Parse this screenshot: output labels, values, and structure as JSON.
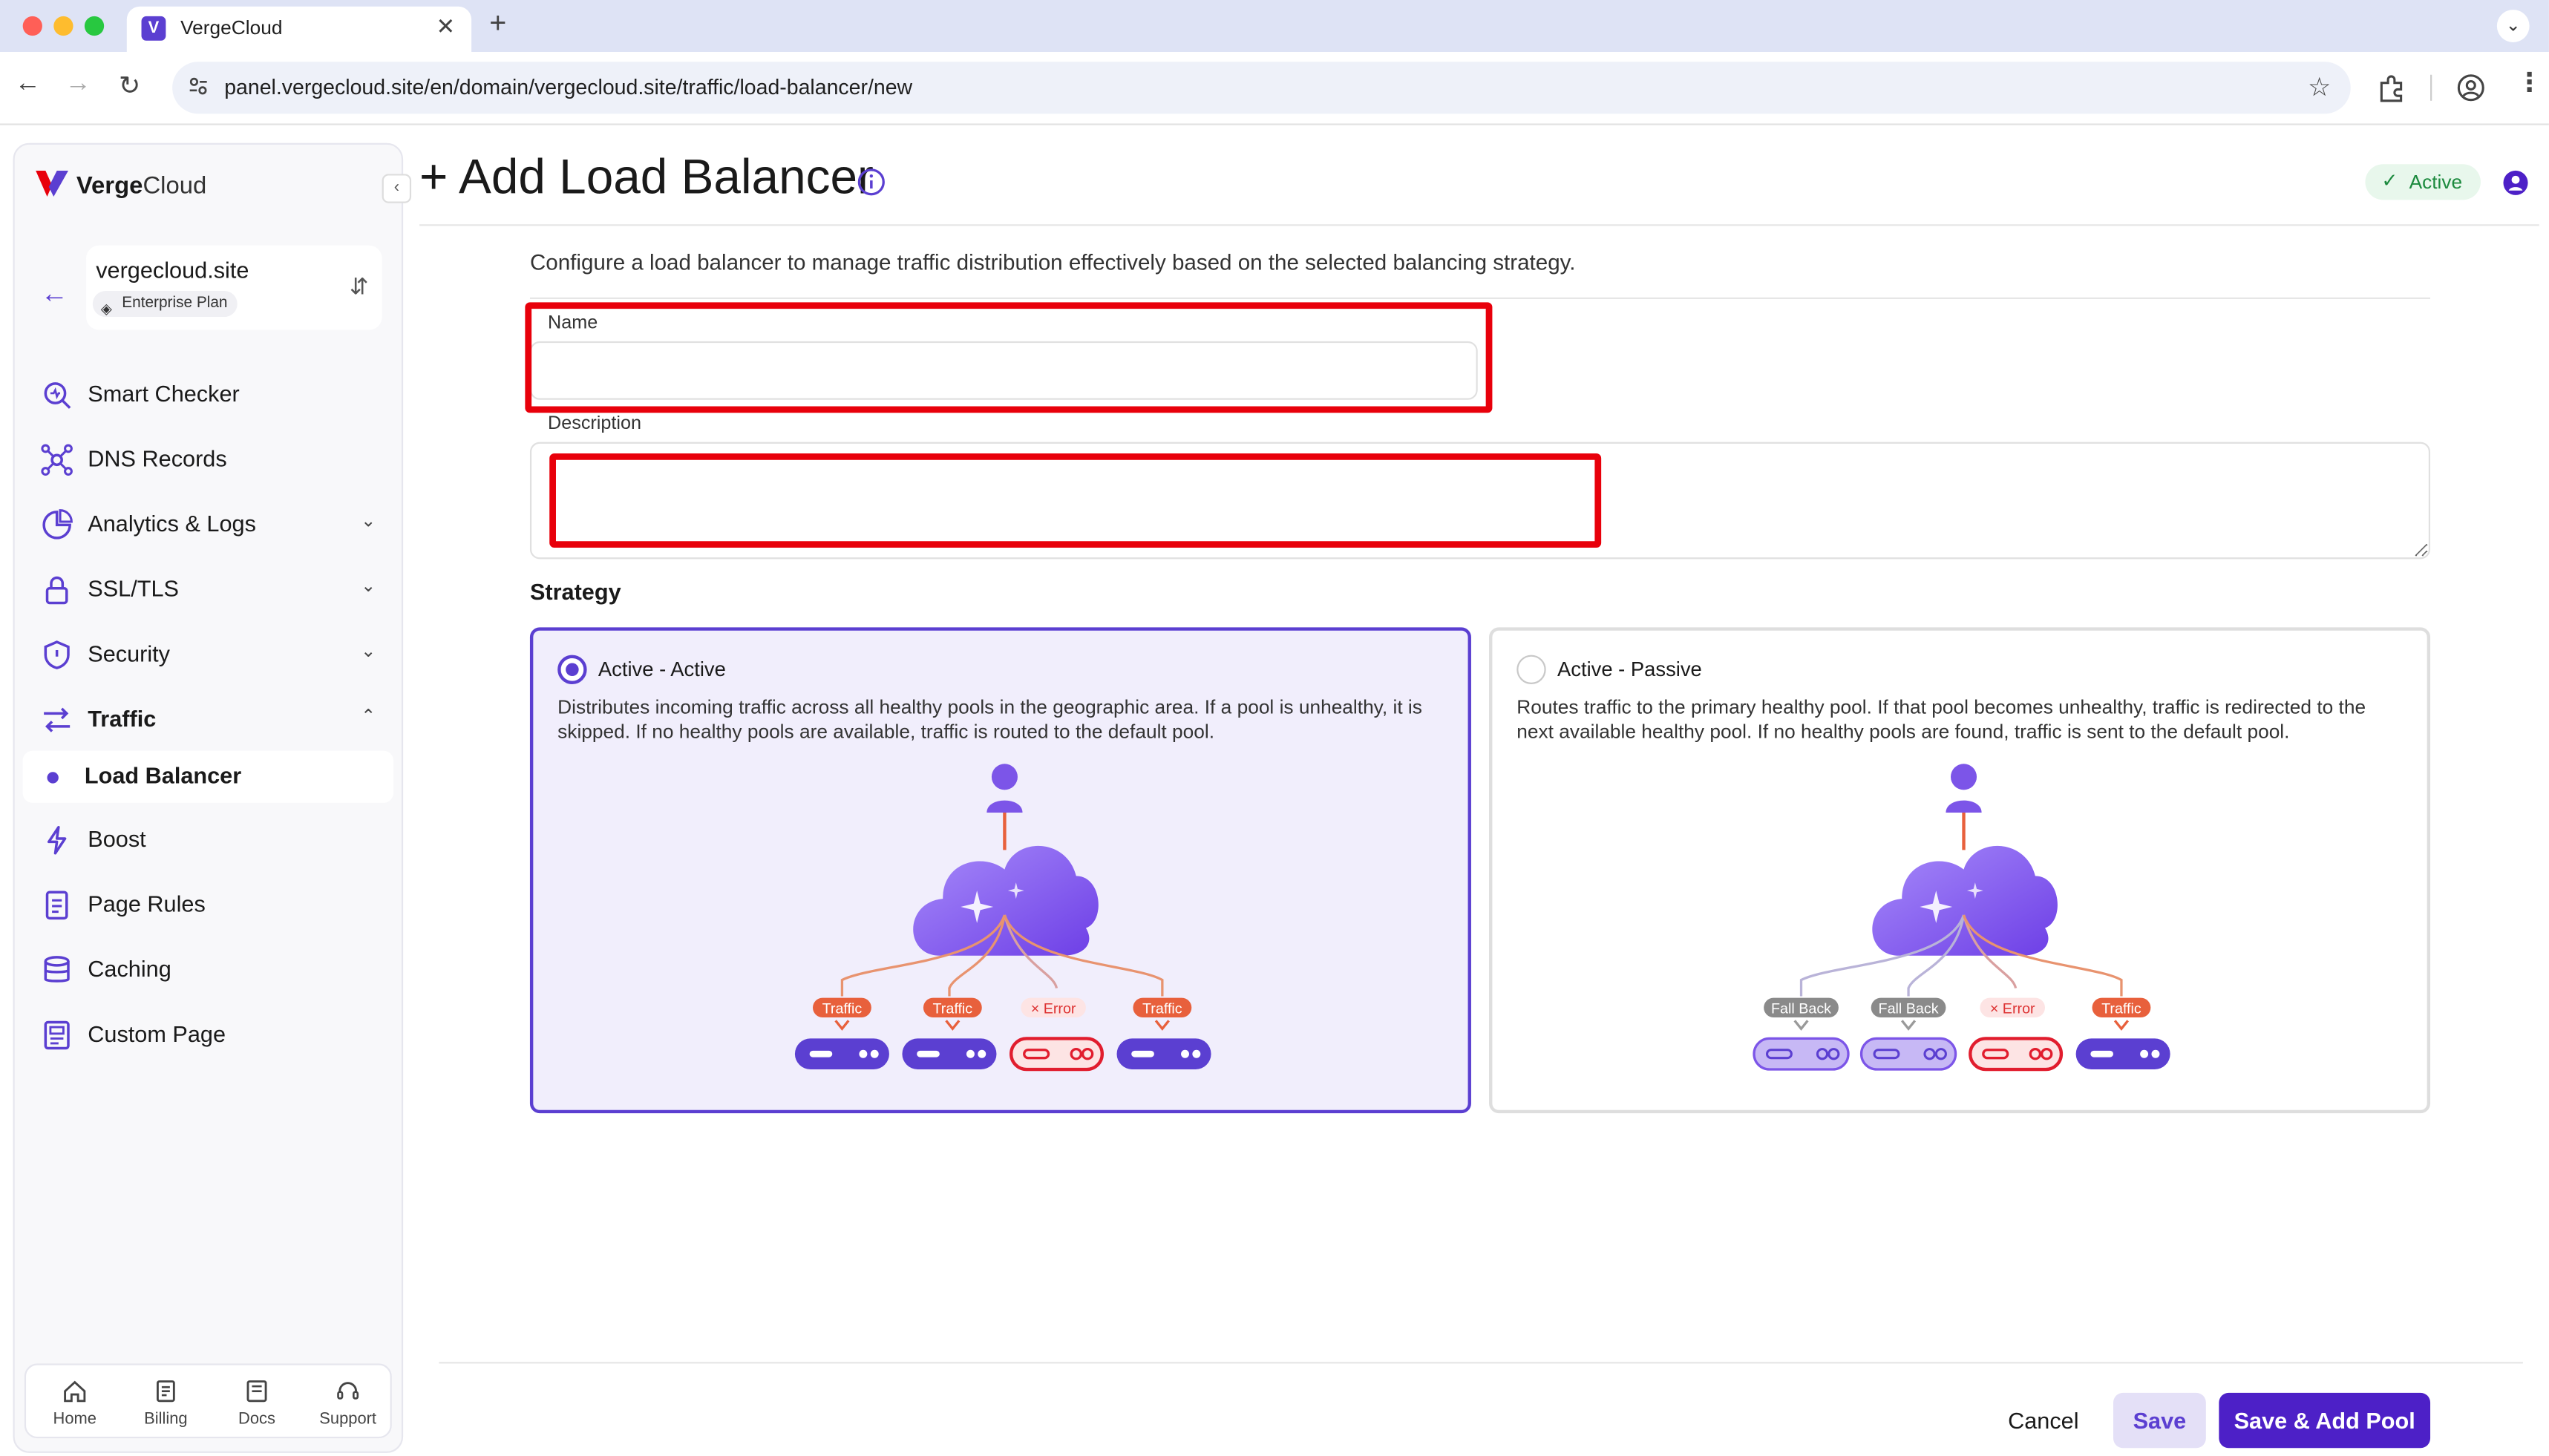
{
  "browser": {
    "tab_title": "VergeCloud",
    "url": "panel.vergecloud.site/en/domain/vergecloud.site/traffic/load-balancer/new"
  },
  "sidebar": {
    "brand": {
      "strong": "Verge",
      "light": "Cloud"
    },
    "site": {
      "name": "vergecloud.site",
      "plan": "Enterprise Plan"
    },
    "items": [
      {
        "label": "Smart Checker",
        "icon": "smart-checker-icon"
      },
      {
        "label": "DNS Records",
        "icon": "dns-icon"
      },
      {
        "label": "Analytics & Logs",
        "icon": "analytics-icon"
      },
      {
        "label": "SSL/TLS",
        "icon": "lock-icon"
      },
      {
        "label": "Security",
        "icon": "shield-icon"
      },
      {
        "label": "Traffic",
        "icon": "traffic-icon"
      },
      {
        "label": "Boost",
        "icon": "bolt-icon"
      },
      {
        "label": "Page Rules",
        "icon": "page-rules-icon"
      },
      {
        "label": "Caching",
        "icon": "database-icon"
      },
      {
        "label": "Custom Page",
        "icon": "custom-page-icon"
      }
    ],
    "active_subitem": "Load Balancer",
    "bottom_nav": [
      {
        "label": "Home",
        "icon": "home-icon"
      },
      {
        "label": "Billing",
        "icon": "billing-icon"
      },
      {
        "label": "Docs",
        "icon": "docs-icon"
      },
      {
        "label": "Support",
        "icon": "support-icon"
      }
    ]
  },
  "header": {
    "title": "+ Add Load Balancer",
    "status": "Active"
  },
  "form": {
    "intro": "Configure a load balancer to manage traffic distribution effectively based on the selected balancing strategy.",
    "name_label": "Name",
    "name_value": "",
    "description_label": "Description",
    "description_value": "",
    "strategy_label": "Strategy"
  },
  "strategies": [
    {
      "title": "Active - Active",
      "selected": true,
      "description": "Distributes incoming traffic across all healthy pools in the geographic area. If a pool is unhealthy, it is skipped. If no healthy pools are available, traffic is routed to the default pool.",
      "labels": [
        "Traffic",
        "Traffic",
        "Error",
        "Traffic"
      ]
    },
    {
      "title": "Active - Passive",
      "selected": false,
      "description": "Routes traffic to the primary healthy pool. If that pool becomes unhealthy, traffic is redirected to the next available healthy pool. If no healthy pools are found, traffic is sent to the default pool.",
      "labels": [
        "Fall Back",
        "Fall Back",
        "Error",
        "Traffic"
      ]
    }
  ],
  "footer": {
    "cancel": "Cancel",
    "save": "Save",
    "save_add_pool": "Save & Add Pool"
  },
  "colors": {
    "accent": "#5b3fd1",
    "primary_button": "#4d20c7",
    "highlight_red": "#e8000b",
    "status_green": "#1c8a3e",
    "traffic_orange": "#e8603c",
    "fallback_gray": "#8a8a8a"
  }
}
